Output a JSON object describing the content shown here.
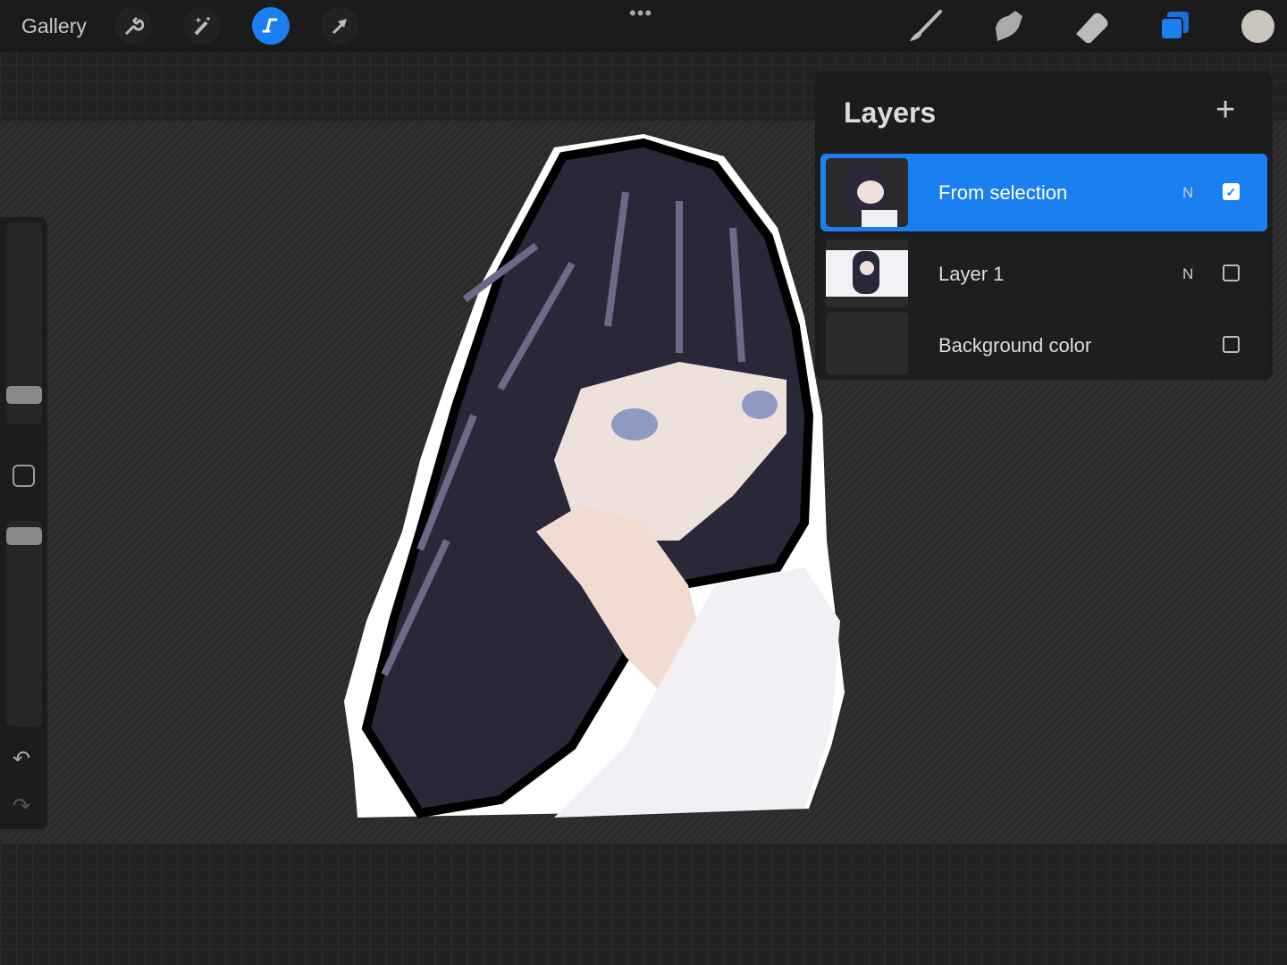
{
  "topbar": {
    "gallery_label": "Gallery",
    "more_label": "•••",
    "tools": [
      "wrench-icon",
      "magic-wand-icon",
      "selection-icon",
      "transform-arrow-icon"
    ],
    "active_tool": "selection-icon",
    "right_tools": [
      "brush-icon",
      "smudge-icon",
      "eraser-icon",
      "layers-icon"
    ],
    "current_color": "#c9c4bd",
    "accent": "#1a7ff0"
  },
  "sidebar": {
    "undo_label": "↶",
    "redo_label": "↷"
  },
  "layers": {
    "title": "Layers",
    "add_label": "+",
    "items": [
      {
        "name": "From selection",
        "blend": "N",
        "visible": true,
        "selected": true
      },
      {
        "name": "Layer 1",
        "blend": "N",
        "visible": false,
        "selected": false
      },
      {
        "name": "Background color",
        "blend": "",
        "visible": false,
        "selected": false
      }
    ]
  }
}
